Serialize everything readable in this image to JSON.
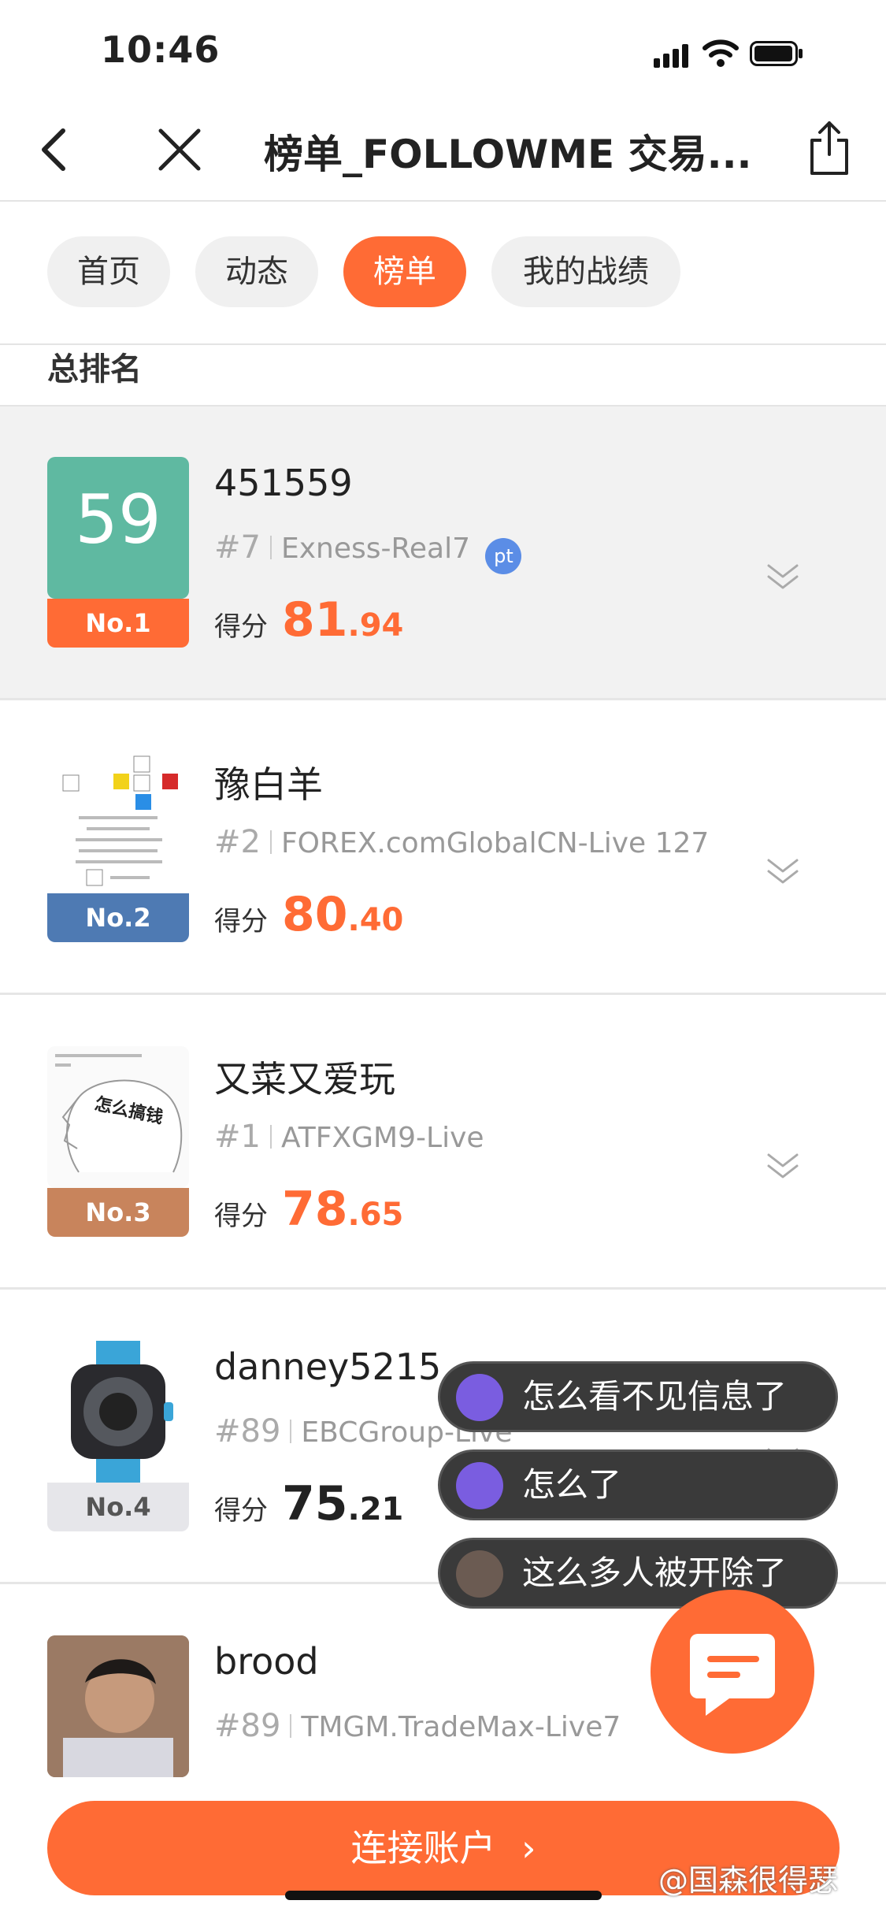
{
  "status_bar": {
    "time": "10:46"
  },
  "nav": {
    "title": "榜单_FOLLOWME 交易..."
  },
  "tabs": [
    {
      "label": "首页",
      "active": false
    },
    {
      "label": "动态",
      "active": false
    },
    {
      "label": "榜单",
      "active": true
    },
    {
      "label": "我的战绩",
      "active": false
    }
  ],
  "section": {
    "title": "总排名"
  },
  "rows": [
    {
      "rank": "No.1",
      "avatar_text": "59",
      "name": "451559",
      "num": "#7",
      "account": "Exness-Real7",
      "badge": "pt",
      "score_label": "得分",
      "score_int": "81",
      "score_dec": ".94",
      "rank_color": "#ff6b35"
    },
    {
      "rank": "No.2",
      "name": "豫白羊",
      "num": "#2",
      "account": "FOREX.comGlobalCN-Live 127",
      "score_label": "得分",
      "score_int": "80",
      "score_dec": ".40",
      "rank_color": "#4e7ab3"
    },
    {
      "rank": "No.3",
      "name": "又菜又爱玩",
      "num": "#1",
      "account": "ATFXGM9-Live",
      "score_label": "得分",
      "score_int": "78",
      "score_dec": ".65",
      "rank_color": "#c8845c",
      "avatar_caption": "怎么搞钱"
    },
    {
      "rank": "No.4",
      "name": "danney5215",
      "num": "#89",
      "account": "EBCGroup-Live",
      "score_label": "得分",
      "score_int": "75",
      "score_dec": ".21",
      "rank_color": "#e6e6ea"
    },
    {
      "name": "brood",
      "num": "#89",
      "account": "TMGM.TradeMax-Live7"
    }
  ],
  "chat_bubbles": [
    "怎么看不见信息了",
    "怎么了",
    "这么多人被开除了"
  ],
  "connect_button": {
    "label": "连接账户"
  },
  "watermark": "@国森很得瑟",
  "colors": {
    "accent": "#ff6b35",
    "avatar1": "#5fb9a1",
    "bubble_bg": "#3a3a3a"
  }
}
